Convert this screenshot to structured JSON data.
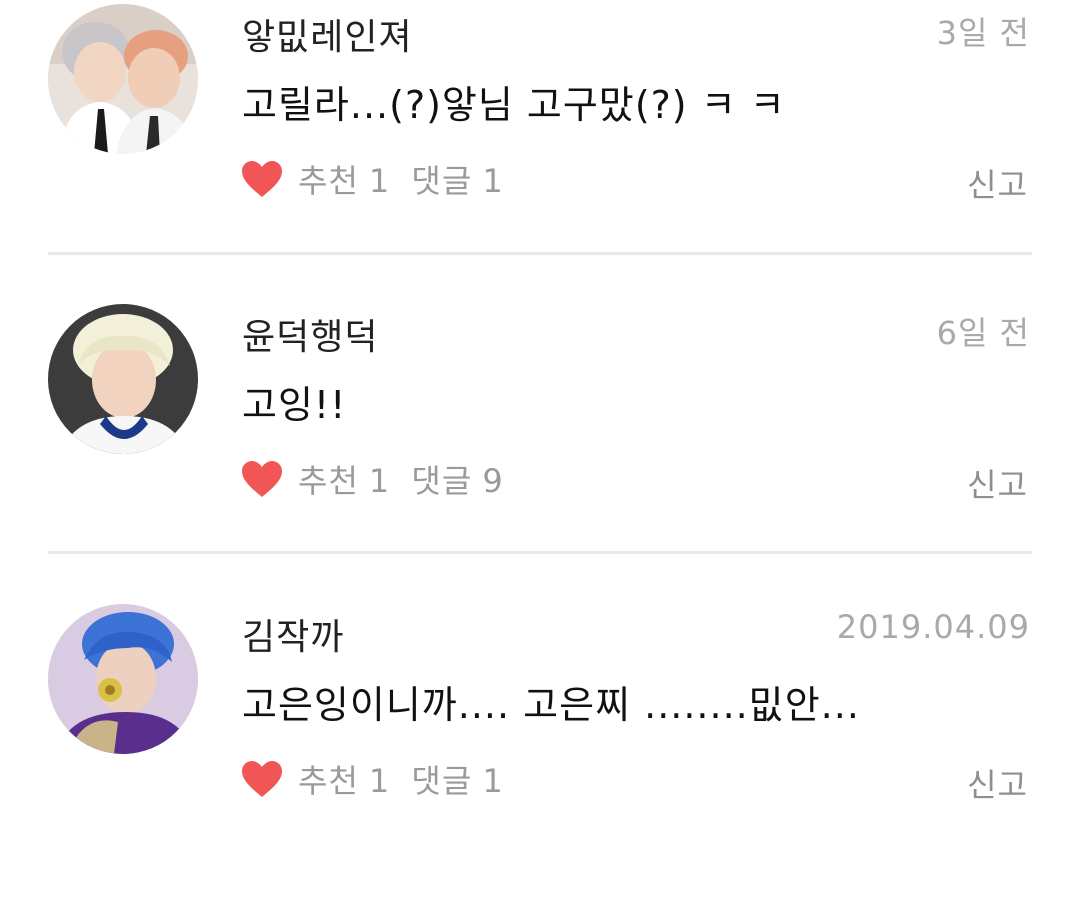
{
  "labels": {
    "recommend": "추천",
    "reply": "댓글",
    "report": "신고"
  },
  "colors": {
    "heart": "#f25555",
    "meta_text": "#9a9a9a",
    "time_text": "#a9a9a9"
  },
  "comments": [
    {
      "username": "앟밊레인져",
      "time": "3일 전",
      "text": "고릴라...(?)앟님 고구맜(?) ㅋ ㅋ",
      "recommend_count": "1",
      "reply_count": "1",
      "avatar_icon": "two-people-selfie-avatar"
    },
    {
      "username": "윤덕행덕",
      "time": "6일 전",
      "text": "고잉!!",
      "recommend_count": "1",
      "reply_count": "9",
      "avatar_icon": "blonde-person-avatar"
    },
    {
      "username": "김작까",
      "time": "2019.04.09",
      "text": "고은잉이니까.... 고은찌 ........밊안...",
      "recommend_count": "1",
      "reply_count": "1",
      "avatar_icon": "blue-hair-person-avatar"
    }
  ]
}
